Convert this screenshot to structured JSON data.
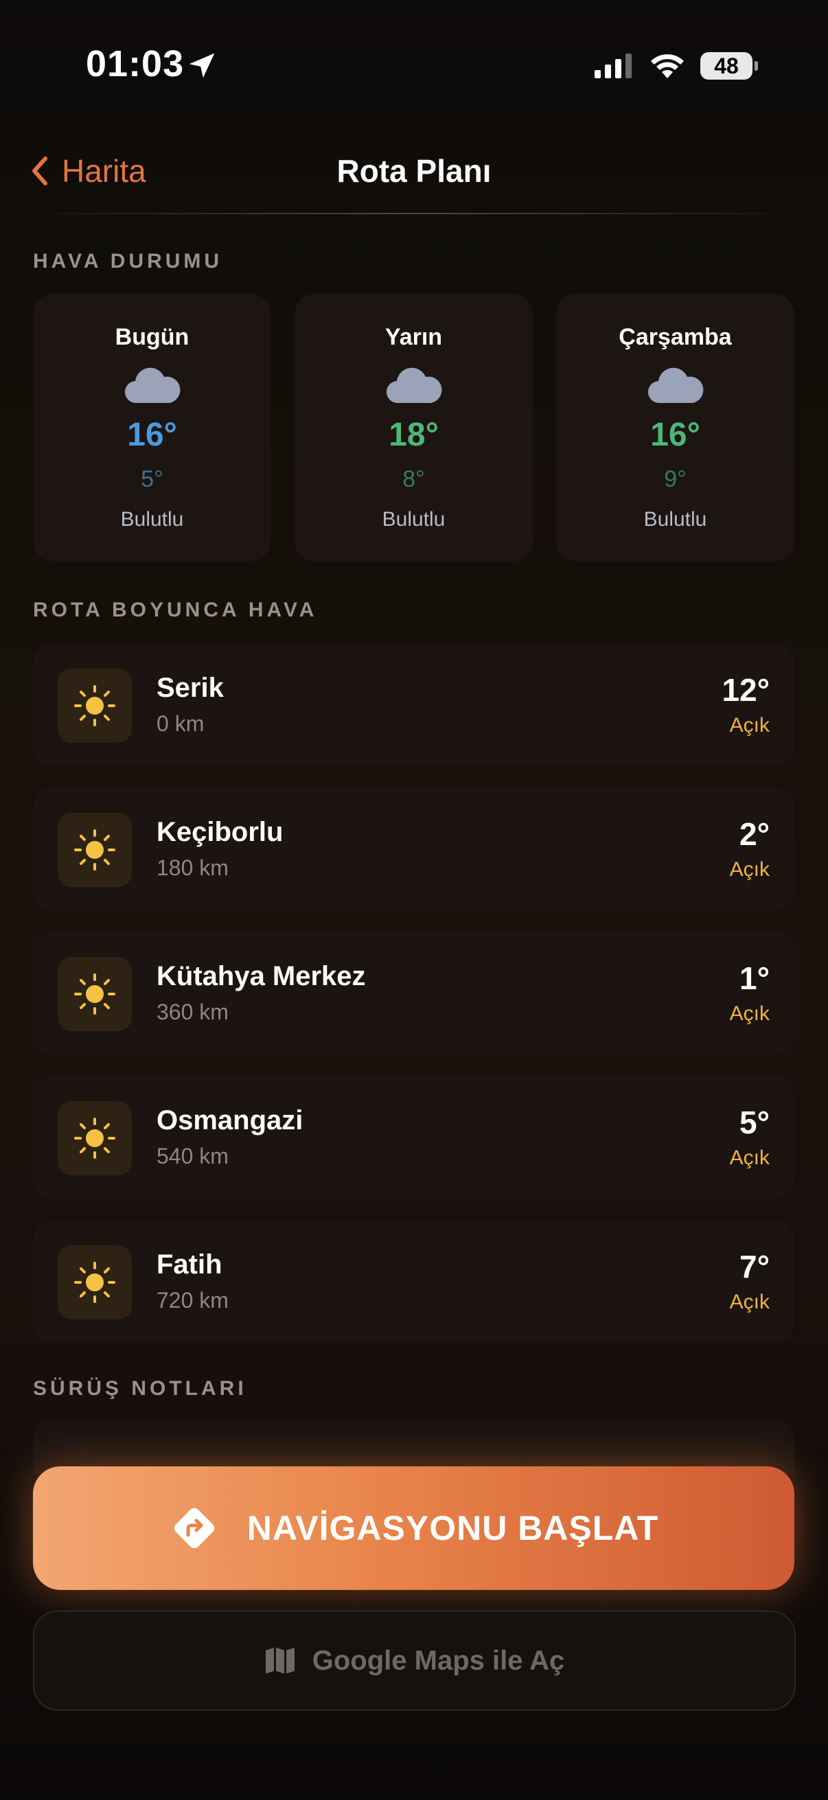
{
  "status_bar": {
    "time": "01:03",
    "battery": "48",
    "icons": [
      "location-arrow-icon",
      "signal-icon",
      "wifi-icon",
      "battery-icon"
    ]
  },
  "header": {
    "back_label": "Harita",
    "title": "Rota Planı"
  },
  "sections": {
    "weather": "HAVA DURUMU",
    "route_weather": "ROTA BOYUNCA HAVA",
    "driving_notes": "SÜRÜŞ NOTLARI"
  },
  "forecast": [
    {
      "day": "Bugün",
      "high": "16°",
      "low": "5°",
      "condition": "Bulutlu",
      "high_color": "#4a9be0",
      "low_color": "#3f6e99",
      "icon": "cloud-icon"
    },
    {
      "day": "Yarın",
      "high": "18°",
      "low": "8°",
      "condition": "Bulutlu",
      "high_color": "#4cb877",
      "low_color": "#3a7a56",
      "icon": "cloud-icon"
    },
    {
      "day": "Çarşamba",
      "high": "16°",
      "low": "9°",
      "condition": "Bulutlu",
      "high_color": "#4cb877",
      "low_color": "#3a7a56",
      "icon": "cloud-icon"
    }
  ],
  "route": [
    {
      "city": "Serik",
      "distance": "0 km",
      "temp": "12°",
      "condition": "Açık",
      "icon": "sun-icon"
    },
    {
      "city": "Keçiborlu",
      "distance": "180 km",
      "temp": "2°",
      "condition": "Açık",
      "icon": "sun-icon"
    },
    {
      "city": "Kütahya Merkez",
      "distance": "360 km",
      "temp": "1°",
      "condition": "Açık",
      "icon": "sun-icon"
    },
    {
      "city": "Osmangazi",
      "distance": "540 km",
      "temp": "5°",
      "condition": "Açık",
      "icon": "sun-icon"
    },
    {
      "city": "Fatih",
      "distance": "720 km",
      "temp": "7°",
      "condition": "Açık",
      "icon": "sun-icon"
    }
  ],
  "actions": {
    "start_navigation": "NAVİGASYONU BAŞLAT",
    "open_google_maps": "Google Maps ile Aç"
  },
  "colors": {
    "accent": "#e27540",
    "sun": "#f5c242",
    "condition": "#f0b53c"
  }
}
